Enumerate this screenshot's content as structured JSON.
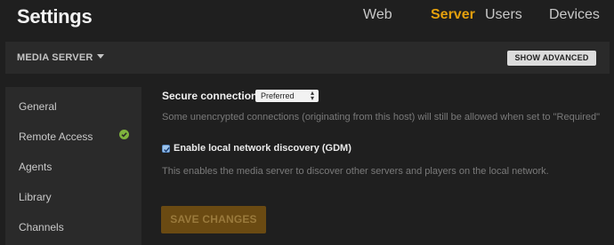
{
  "header": {
    "title": "Settings",
    "tabs": [
      {
        "label": "Web",
        "active": false
      },
      {
        "label": "Server",
        "active": true
      },
      {
        "label": "Users",
        "active": false
      },
      {
        "label": "Devices",
        "active": false
      }
    ]
  },
  "section": {
    "title": "MEDIA SERVER",
    "show_advanced_label": "SHOW ADVANCED"
  },
  "sidebar": {
    "items": [
      {
        "label": "General"
      },
      {
        "label": "Remote Access",
        "status_icon": "check-icon"
      },
      {
        "label": "Agents"
      },
      {
        "label": "Library"
      },
      {
        "label": "Channels"
      }
    ]
  },
  "main": {
    "secure_connections": {
      "label": "Secure connections",
      "value": "Preferred",
      "help": "Some unencrypted connections (originating from this host) will still be allowed when set to \"Required\""
    },
    "gdm": {
      "checked": true,
      "label": "Enable local network discovery (GDM)",
      "help": "This enables the media server to discover other servers and players on the local network."
    },
    "save_label": "SAVE CHANGES"
  },
  "colors": {
    "accent": "#e5a00d",
    "background": "#1f1f1f",
    "panel": "#2a2a2a",
    "success": "#7fb33d"
  }
}
